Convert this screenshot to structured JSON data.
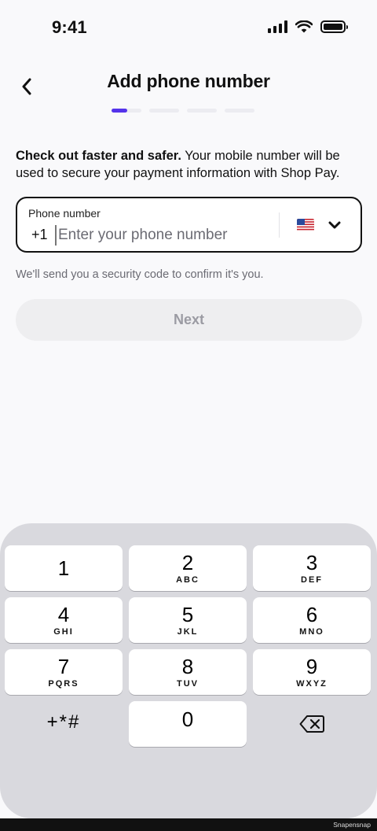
{
  "status_bar": {
    "time": "9:41"
  },
  "header": {
    "title": "Add phone number",
    "back_icon": "chevron-left-icon"
  },
  "progress": {
    "current_step": 1,
    "total_steps": 4,
    "accent_color": "#5433eb"
  },
  "description": {
    "bold": "Check out faster and safer.",
    "rest": " Your mobile number will be used to secure your payment information with Shop Pay."
  },
  "phone_field": {
    "label": "Phone number",
    "country_code": "+1",
    "placeholder": "Enter your phone number",
    "value": "",
    "country_flag": "us-flag-icon"
  },
  "helper_text": "We'll send you a security code to confirm it's you.",
  "next_button": {
    "label": "Next",
    "enabled": false
  },
  "keypad": {
    "keys": [
      {
        "digit": "1",
        "letters": ""
      },
      {
        "digit": "2",
        "letters": "ABC"
      },
      {
        "digit": "3",
        "letters": "DEF"
      },
      {
        "digit": "4",
        "letters": "GHI"
      },
      {
        "digit": "5",
        "letters": "JKL"
      },
      {
        "digit": "6",
        "letters": "MNO"
      },
      {
        "digit": "7",
        "letters": "PQRS"
      },
      {
        "digit": "8",
        "letters": "TUV"
      },
      {
        "digit": "9",
        "letters": "WXYZ"
      },
      {
        "digit": "0",
        "letters": ""
      }
    ],
    "symbols_label": "+*#",
    "delete_icon": "backspace-icon"
  },
  "watermark": "Snapensnap"
}
